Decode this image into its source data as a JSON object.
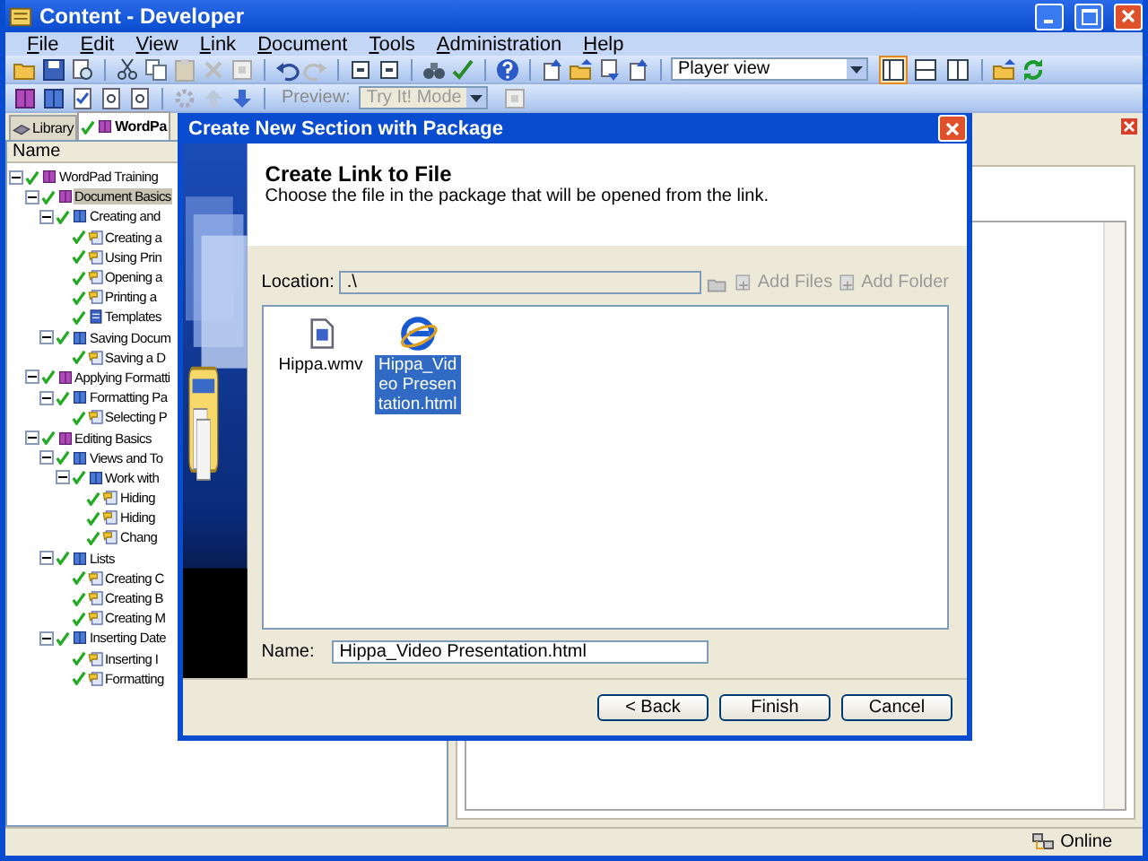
{
  "window": {
    "title": "Content - Developer"
  },
  "menu": [
    "File",
    "Edit",
    "View",
    "Link",
    "Document",
    "Tools",
    "Administration",
    "Help"
  ],
  "toolbar": {
    "view_select": {
      "value": "Player view"
    },
    "layout_toggles": [
      {
        "selected": true
      },
      {
        "selected": false
      },
      {
        "selected": false
      }
    ],
    "preview_label": "Preview:",
    "preview_select": {
      "value": "Try It! Mode",
      "disabled": true
    }
  },
  "tabs": [
    {
      "label": "Library",
      "selected": false
    },
    {
      "label": "WordPa",
      "selected": true
    }
  ],
  "tree": {
    "column": "Name",
    "items": [
      {
        "label": "WordPad Training",
        "kind": "module",
        "checked": true,
        "selected": false,
        "expanded": true,
        "children": [
          {
            "label": "Document Basics",
            "kind": "module",
            "checked": true,
            "selected": true,
            "expanded": true,
            "children": [
              {
                "label": "Creating and",
                "kind": "section",
                "checked": true,
                "selected": false,
                "expanded": true,
                "children": [
                  {
                    "label": "Creating a",
                    "kind": "topic",
                    "checked": true,
                    "selected": false
                  },
                  {
                    "label": "Using Prin",
                    "kind": "topic",
                    "checked": true,
                    "selected": false
                  },
                  {
                    "label": "Opening a",
                    "kind": "topic",
                    "checked": true,
                    "selected": false
                  },
                  {
                    "label": "Printing a",
                    "kind": "topic",
                    "checked": true,
                    "selected": false
                  },
                  {
                    "label": "Templates",
                    "kind": "document",
                    "checked": true,
                    "selected": false
                  }
                ]
              },
              {
                "label": "Saving Docum",
                "kind": "section",
                "checked": true,
                "selected": false,
                "expanded": true,
                "children": [
                  {
                    "label": "Saving a D",
                    "kind": "topic",
                    "checked": true,
                    "selected": false
                  }
                ]
              }
            ]
          },
          {
            "label": "Applying Formatti",
            "kind": "module",
            "checked": true,
            "selected": false,
            "expanded": true,
            "children": [
              {
                "label": "Formatting Pa",
                "kind": "section",
                "checked": true,
                "selected": false,
                "expanded": true,
                "children": [
                  {
                    "label": "Selecting P",
                    "kind": "topic",
                    "checked": true,
                    "selected": false
                  }
                ]
              }
            ]
          },
          {
            "label": "Editing Basics",
            "kind": "module",
            "checked": true,
            "selected": false,
            "expanded": true,
            "children": [
              {
                "label": "Views and To",
                "kind": "section",
                "checked": true,
                "selected": false,
                "expanded": true,
                "children": [
                  {
                    "label": "Work with",
                    "kind": "section",
                    "checked": true,
                    "selected": false,
                    "expanded": true,
                    "children": [
                      {
                        "label": "Hiding",
                        "kind": "topic",
                        "checked": true,
                        "selected": false
                      },
                      {
                        "label": "Hiding",
                        "kind": "topic",
                        "checked": true,
                        "selected": false
                      },
                      {
                        "label": "Chang",
                        "kind": "topic",
                        "checked": true,
                        "selected": false
                      }
                    ]
                  }
                ]
              },
              {
                "label": "Lists",
                "kind": "section",
                "checked": true,
                "selected": false,
                "expanded": true,
                "children": [
                  {
                    "label": "Creating C",
                    "kind": "topic",
                    "checked": true,
                    "selected": false
                  },
                  {
                    "label": "Creating B",
                    "kind": "topic",
                    "checked": true,
                    "selected": false
                  },
                  {
                    "label": "Creating M",
                    "kind": "topic",
                    "checked": true,
                    "selected": false
                  }
                ]
              },
              {
                "label": "Inserting Date",
                "kind": "section",
                "checked": true,
                "selected": false,
                "expanded": true,
                "children": [
                  {
                    "label": "Inserting I",
                    "kind": "topic",
                    "checked": true,
                    "selected": false
                  },
                  {
                    "label": "Formatting",
                    "kind": "topic",
                    "checked": true,
                    "selected": false
                  }
                ]
              }
            ]
          }
        ]
      }
    ]
  },
  "dialog": {
    "title": "Create New Section with Package",
    "heading": "Create Link to File",
    "description": "Choose the file in the package that will be opened from the link.",
    "location": {
      "label": "Location:",
      "value": ".\\"
    },
    "actions": [
      {
        "label": "Add Files",
        "disabled": true
      },
      {
        "label": "Add Folder",
        "disabled": true
      }
    ],
    "files": [
      {
        "name": "Hippa.wmv",
        "kind": "video",
        "selected": false
      },
      {
        "name": "Hippa_Video Presentation.html",
        "kind": "web",
        "selected": true
      }
    ],
    "name_field": {
      "label": "Name:",
      "value": "Hippa_Video Presentation.html"
    },
    "buttons": [
      "< Back",
      "Finish",
      "Cancel"
    ]
  },
  "status_bar": {
    "status": "Online"
  }
}
